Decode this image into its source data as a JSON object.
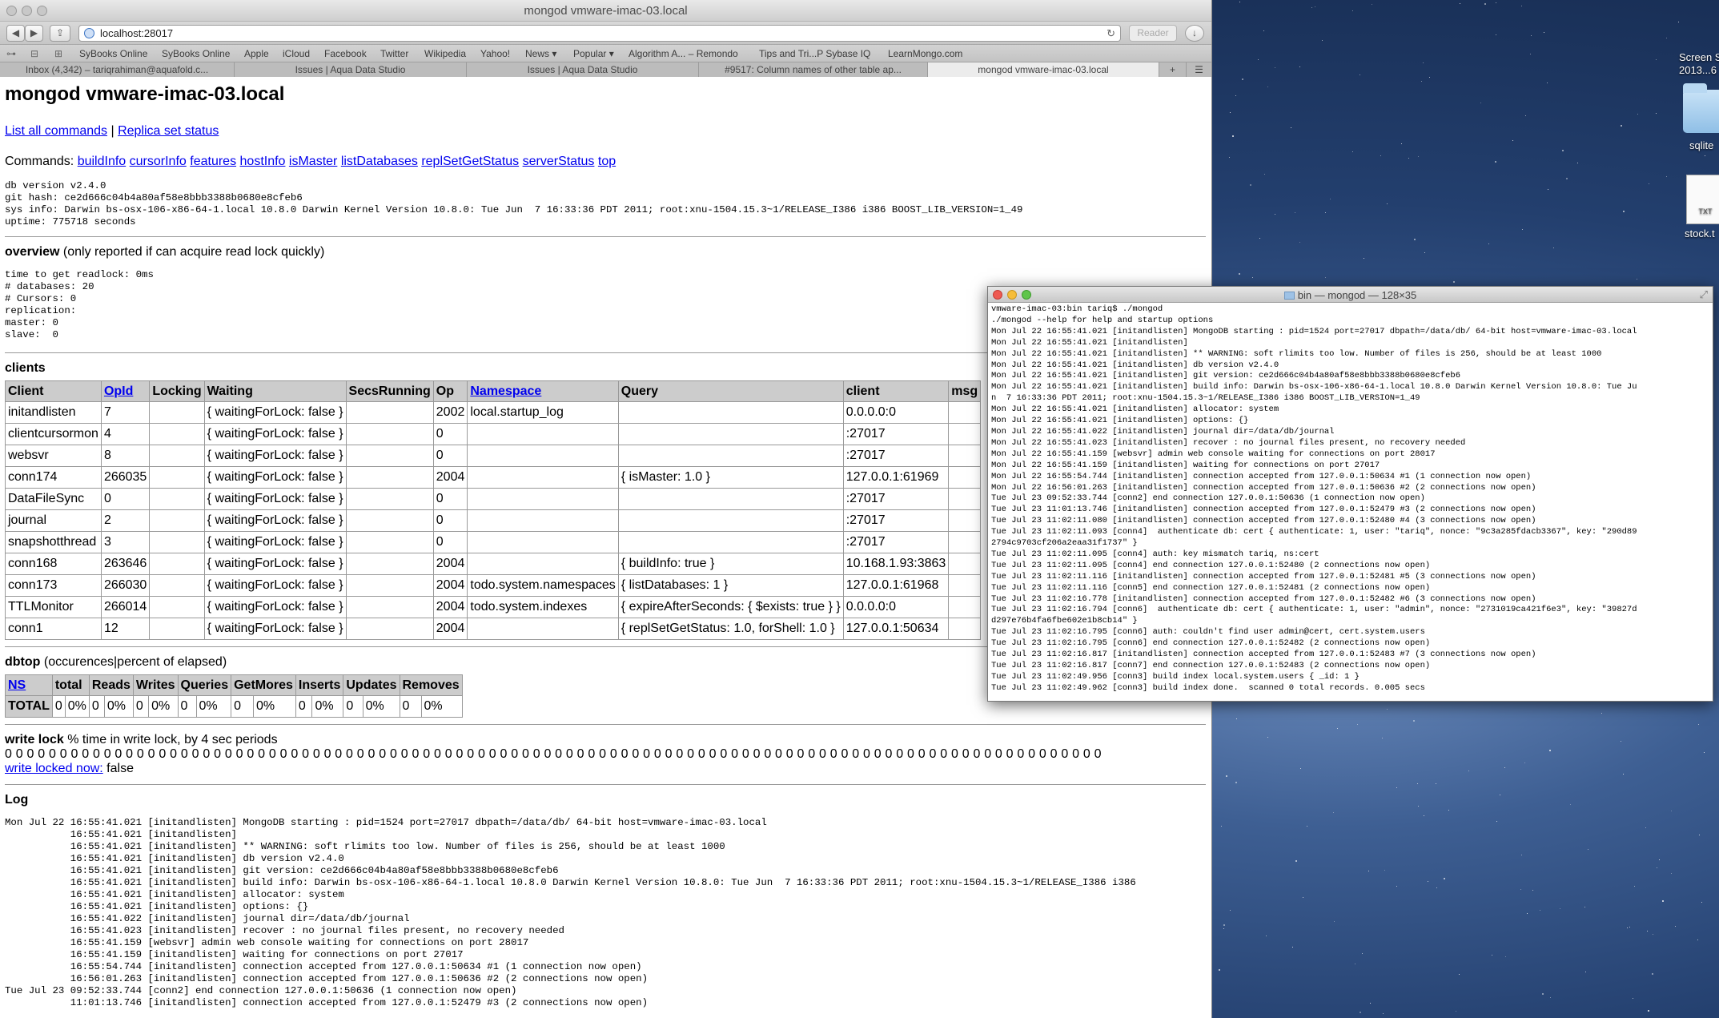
{
  "window_title": "mongod vmware-imac-03.local",
  "url": "localhost:28017",
  "reader_label": "Reader",
  "bookmarks": [
    "SyBooks Online",
    "SyBooks Online",
    "Apple",
    "iCloud",
    "Facebook",
    "Twitter",
    "Wikipedia",
    "Yahoo!",
    "News ▾",
    "Popular ▾",
    "Algorithm A... – Remondo",
    "Tips and Tri...P Sybase IQ",
    "LearnMongo.com"
  ],
  "tabs": [
    "Inbox (4,342) – tariqrahiman@aquafold.c...",
    "Issues | Aqua Data Studio",
    "Issues | Aqua Data Studio",
    "#9517: Column names of other table ap...",
    "mongod vmware-imac-03.local"
  ],
  "page": {
    "title": "mongod vmware-imac-03.local",
    "list_commands": "List all commands",
    "separator": " | ",
    "replica_set": "Replica set status",
    "commands_label": "Commands: ",
    "commands": [
      "buildInfo",
      "cursorInfo",
      "features",
      "hostInfo",
      "isMaster",
      "listDatabases",
      "replSetGetStatus",
      "serverStatus",
      "top"
    ],
    "version_block": "db version v2.4.0\ngit hash: ce2d666c04b4a80af58e8bbb3388b0680e8cfeb6\nsys info: Darwin bs-osx-106-x86-64-1.local 10.8.0 Darwin Kernel Version 10.8.0: Tue Jun  7 16:33:36 PDT 2011; root:xnu-1504.15.3~1/RELEASE_I386 i386 BOOST_LIB_VERSION=1_49\nuptime: 775718 seconds",
    "overview_title": "overview",
    "overview_note": " (only reported if can acquire read lock quickly)",
    "overview_block": "time to get readlock: 0ms\n# databases: 20\n# Cursors: 0\nreplication:\nmaster: 0\nslave:  0",
    "clients_title": "clients",
    "clients_headers": [
      "Client",
      "OpId",
      "Locking",
      "Waiting",
      "SecsRunning",
      "Op",
      "Namespace",
      "Query",
      "client",
      "msg"
    ],
    "clients_rows": [
      [
        "initandlisten",
        "7",
        "",
        "{ waitingForLock: false }",
        "",
        "2002",
        "local.startup_log",
        "",
        "0.0.0.0:0",
        ""
      ],
      [
        "clientcursormon",
        "4",
        "",
        "{ waitingForLock: false }",
        "",
        "0",
        "",
        "",
        ":27017",
        ""
      ],
      [
        "websvr",
        "8",
        "",
        "{ waitingForLock: false }",
        "",
        "0",
        "",
        "",
        ":27017",
        ""
      ],
      [
        "conn174",
        "266035",
        "",
        "{ waitingForLock: false }",
        "",
        "2004",
        "",
        "{ isMaster: 1.0 }",
        "127.0.0.1:61969",
        ""
      ],
      [
        "DataFileSync",
        "0",
        "",
        "{ waitingForLock: false }",
        "",
        "0",
        "",
        "",
        ":27017",
        ""
      ],
      [
        "journal",
        "2",
        "",
        "{ waitingForLock: false }",
        "",
        "0",
        "",
        "",
        ":27017",
        ""
      ],
      [
        "snapshotthread",
        "3",
        "",
        "{ waitingForLock: false }",
        "",
        "0",
        "",
        "",
        ":27017",
        ""
      ],
      [
        "conn168",
        "263646",
        "",
        "{ waitingForLock: false }",
        "",
        "2004",
        "",
        "{ buildInfo: true }",
        "10.168.1.93:3863",
        ""
      ],
      [
        "conn173",
        "266030",
        "",
        "{ waitingForLock: false }",
        "",
        "2004",
        "todo.system.namespaces",
        "{ listDatabases: 1 }",
        "127.0.0.1:61968",
        ""
      ],
      [
        "TTLMonitor",
        "266014",
        "",
        "{ waitingForLock: false }",
        "",
        "2004",
        "todo.system.indexes",
        "{ expireAfterSeconds: { $exists: true } }",
        "0.0.0.0:0",
        ""
      ],
      [
        "conn1",
        "12",
        "",
        "{ waitingForLock: false }",
        "",
        "2004",
        "",
        "{ replSetGetStatus: 1.0, forShell: 1.0 }",
        "127.0.0.1:50634",
        ""
      ]
    ],
    "dbtop_title": "dbtop",
    "dbtop_note": " (occurences|percent of elapsed)",
    "dbtop_headers": [
      "NS",
      "total",
      "Reads",
      "Writes",
      "Queries",
      "GetMores",
      "Inserts",
      "Updates",
      "Removes"
    ],
    "dbtop_row": [
      "TOTAL",
      "0",
      "0%",
      "0",
      "0%",
      "0",
      "0%",
      "0",
      "0%",
      "0",
      "0%",
      "0",
      "0%",
      "0",
      "0%",
      "0",
      "0%"
    ],
    "writelock_title": "write lock",
    "writelock_note": " % time in write lock, by 4 sec periods",
    "writelock_values": "0 0 0 0 0 0 0 0 0 0 0 0 0 0 0 0 0 0 0 0 0 0 0 0 0 0 0 0 0 0 0 0 0 0 0 0 0 0 0 0 0 0 0 0 0 0 0 0 0 0 0 0 0 0 0 0 0 0 0 0 0 0 0 0 0 0 0 0 0 0 0 0 0 0 0 0 0 0 0 0 0 0 0 0 0 0 0 0 0 0 0 0 0 0 0 0 0 0 0 0",
    "writelock_link": "write locked now:",
    "writelock_now": " false",
    "log_title": "Log",
    "log_block": "Mon Jul 22 16:55:41.021 [initandlisten] MongoDB starting : pid=1524 port=27017 dbpath=/data/db/ 64-bit host=vmware-imac-03.local\n           16:55:41.021 [initandlisten]\n           16:55:41.021 [initandlisten] ** WARNING: soft rlimits too low. Number of files is 256, should be at least 1000\n           16:55:41.021 [initandlisten] db version v2.4.0\n           16:55:41.021 [initandlisten] git version: ce2d666c04b4a80af58e8bbb3388b0680e8cfeb6\n           16:55:41.021 [initandlisten] build info: Darwin bs-osx-106-x86-64-1.local 10.8.0 Darwin Kernel Version 10.8.0: Tue Jun  7 16:33:36 PDT 2011; root:xnu-1504.15.3~1/RELEASE_I386 i386\n           16:55:41.021 [initandlisten] allocator: system\n           16:55:41.021 [initandlisten] options: {}\n           16:55:41.022 [initandlisten] journal dir=/data/db/journal\n           16:55:41.023 [initandlisten] recover : no journal files present, no recovery needed\n           16:55:41.159 [websvr] admin web console waiting for connections on port 28017\n           16:55:41.159 [initandlisten] waiting for connections on port 27017\n           16:55:54.744 [initandlisten] connection accepted from 127.0.0.1:50634 #1 (1 connection now open)\n           16:56:01.263 [initandlisten] connection accepted from 127.0.0.1:50636 #2 (2 connections now open)\nTue Jul 23 09:52:33.744 [conn2] end connection 127.0.0.1:50636 (1 connection now open)\n           11:01:13.746 [initandlisten] connection accepted from 127.0.0.1:52479 #3 (2 connections now open)"
  },
  "terminal": {
    "title": "bin — mongod — 128×35",
    "content": "vmware-imac-03:bin tariq$ ./mongod\n./mongod --help for help and startup options\nMon Jul 22 16:55:41.021 [initandlisten] MongoDB starting : pid=1524 port=27017 dbpath=/data/db/ 64-bit host=vmware-imac-03.local\nMon Jul 22 16:55:41.021 [initandlisten]\nMon Jul 22 16:55:41.021 [initandlisten] ** WARNING: soft rlimits too low. Number of files is 256, should be at least 1000\nMon Jul 22 16:55:41.021 [initandlisten] db version v2.4.0\nMon Jul 22 16:55:41.021 [initandlisten] git version: ce2d666c04b4a80af58e8bbb3388b0680e8cfeb6\nMon Jul 22 16:55:41.021 [initandlisten] build info: Darwin bs-osx-106-x86-64-1.local 10.8.0 Darwin Kernel Version 10.8.0: Tue Ju\nn  7 16:33:36 PDT 2011; root:xnu-1504.15.3~1/RELEASE_I386 i386 BOOST_LIB_VERSION=1_49\nMon Jul 22 16:55:41.021 [initandlisten] allocator: system\nMon Jul 22 16:55:41.021 [initandlisten] options: {}\nMon Jul 22 16:55:41.022 [initandlisten] journal dir=/data/db/journal\nMon Jul 22 16:55:41.023 [initandlisten] recover : no journal files present, no recovery needed\nMon Jul 22 16:55:41.159 [websvr] admin web console waiting for connections on port 28017\nMon Jul 22 16:55:41.159 [initandlisten] waiting for connections on port 27017\nMon Jul 22 16:55:54.744 [initandlisten] connection accepted from 127.0.0.1:50634 #1 (1 connection now open)\nMon Jul 22 16:56:01.263 [initandlisten] connection accepted from 127.0.0.1:50636 #2 (2 connections now open)\nTue Jul 23 09:52:33.744 [conn2] end connection 127.0.0.1:50636 (1 connection now open)\nTue Jul 23 11:01:13.746 [initandlisten] connection accepted from 127.0.0.1:52479 #3 (2 connections now open)\nTue Jul 23 11:02:11.080 [initandlisten] connection accepted from 127.0.0.1:52480 #4 (3 connections now open)\nTue Jul 23 11:02:11.093 [conn4]  authenticate db: cert { authenticate: 1, user: \"tariq\", nonce: \"9c3a285fdacb3367\", key: \"290d89\n2794c9703cf206a2eaa31f1737\" }\nTue Jul 23 11:02:11.095 [conn4] auth: key mismatch tariq, ns:cert\nTue Jul 23 11:02:11.095 [conn4] end connection 127.0.0.1:52480 (2 connections now open)\nTue Jul 23 11:02:11.116 [initandlisten] connection accepted from 127.0.0.1:52481 #5 (3 connections now open)\nTue Jul 23 11:02:11.116 [conn5] end connection 127.0.0.1:52481 (2 connections now open)\nTue Jul 23 11:02:16.778 [initandlisten] connection accepted from 127.0.0.1:52482 #6 (3 connections now open)\nTue Jul 23 11:02:16.794 [conn6]  authenticate db: cert { authenticate: 1, user: \"admin\", nonce: \"2731019ca421f6e3\", key: \"39827d\nd297e76b4fa6fbe602e1b8cb14\" }\nTue Jul 23 11:02:16.795 [conn6] auth: couldn't find user admin@cert, cert.system.users\nTue Jul 23 11:02:16.795 [conn6] end connection 127.0.0.1:52482 (2 connections now open)\nTue Jul 23 11:02:16.817 [initandlisten] connection accepted from 127.0.0.1:52483 #7 (3 connections now open)\nTue Jul 23 11:02:16.817 [conn7] end connection 127.0.0.1:52483 (2 connections now open)\nTue Jul 23 11:02:49.956 [conn3] build index local.system.users { _id: 1 }\nTue Jul 23 11:02:49.962 [conn3] build index done.  scanned 0 total records. 0.005 secs"
  },
  "desktop_icons": [
    "Screen S\n2013...6",
    "sqlite",
    "stock.t"
  ],
  "desktop_icon_badge": "TXT"
}
